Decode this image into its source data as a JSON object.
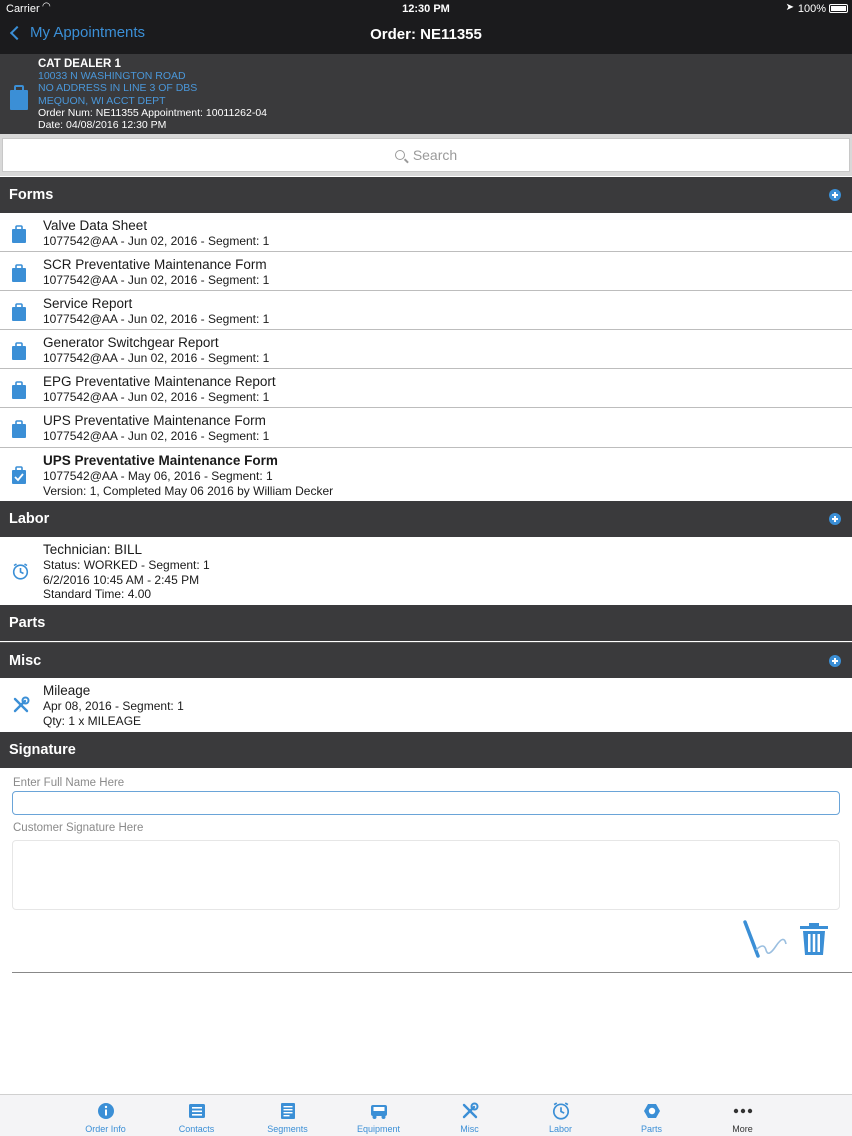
{
  "status_bar": {
    "carrier": "Carrier",
    "time": "12:30 PM",
    "battery": "100%"
  },
  "nav": {
    "back_label": "My Appointments",
    "title": "Order: NE11355"
  },
  "order_header": {
    "dealer": "CAT DEALER 1",
    "address_lines": [
      "10033 N WASHINGTON ROAD",
      "NO ADDRESS IN LINE 3 OF DBS",
      "MEQUON, WI ACCT DEPT"
    ],
    "order_line": "Order Num: NE11355 Appointment: 10011262-04",
    "date_line": "Date: 04/08/2016 12:30 PM"
  },
  "search": {
    "placeholder": "Search"
  },
  "sections": {
    "forms": "Forms",
    "labor": "Labor",
    "parts": "Parts",
    "misc": "Misc",
    "signature": "Signature"
  },
  "forms": [
    {
      "title": "Valve Data Sheet",
      "subtitle": "1077542@AA - Jun 02, 2016 - Segment: 1",
      "icon": "clipboard-icon"
    },
    {
      "title": "SCR Preventative Maintenance Form",
      "subtitle": "1077542@AA - Jun 02, 2016 - Segment: 1",
      "icon": "clipboard-icon"
    },
    {
      "title": "Service Report",
      "subtitle": "1077542@AA - Jun 02, 2016 - Segment: 1",
      "icon": "clipboard-icon"
    },
    {
      "title": "Generator Switchgear Report",
      "subtitle": "1077542@AA - Jun 02, 2016 - Segment: 1",
      "icon": "clipboard-icon"
    },
    {
      "title": "EPG Preventative Maintenance Report",
      "subtitle": "1077542@AA - Jun 02, 2016 - Segment: 1",
      "icon": "clipboard-icon"
    },
    {
      "title": "UPS Preventative Maintenance Form",
      "subtitle": "1077542@AA - Jun 02, 2016 - Segment: 1",
      "icon": "clipboard-icon"
    },
    {
      "title": "UPS Preventative Maintenance Form",
      "subtitle": "1077542@AA - May 06, 2016 - Segment: 1",
      "extra": "Version: 1, Completed May 06 2016 by William Decker",
      "icon": "clipboard-check-icon"
    }
  ],
  "labor": [
    {
      "title": "Technician: BILL",
      "lines": [
        "Status: WORKED - Segment: 1",
        "6/2/2016  10:45 AM - 2:45 PM",
        "Standard Time: 4.00"
      ]
    }
  ],
  "misc": [
    {
      "title": "Mileage",
      "lines": [
        "Apr 08, 2016 - Segment: 1",
        "Qty: 1 x MILEAGE"
      ]
    }
  ],
  "signature": {
    "name_placeholder": "Enter Full Name Here",
    "signature_label": "Customer Signature Here"
  },
  "tabs": [
    {
      "label": "Order Info",
      "icon": "info-icon"
    },
    {
      "label": "Contacts",
      "icon": "contacts-icon"
    },
    {
      "label": "Segments",
      "icon": "segments-icon"
    },
    {
      "label": "Equipment",
      "icon": "equipment-icon"
    },
    {
      "label": "Misc",
      "icon": "tools-icon"
    },
    {
      "label": "Labor",
      "icon": "clock-icon"
    },
    {
      "label": "Parts",
      "icon": "hex-nut-icon"
    },
    {
      "label": "More",
      "icon": "more-icon"
    }
  ],
  "colors": {
    "accent": "#3b8fd6",
    "header_bg": "#3a3a3c",
    "nav_bg": "#1b1b1d"
  }
}
